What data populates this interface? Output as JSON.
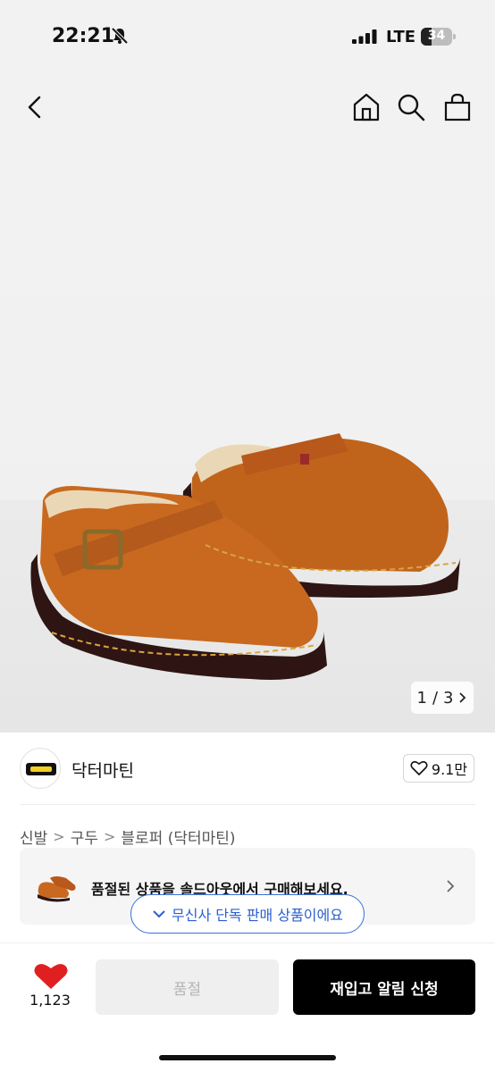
{
  "status_bar": {
    "time": "22:21",
    "network": "LTE",
    "battery": "34",
    "battery_level_percent": 34
  },
  "nav": {
    "icons": [
      "back-icon",
      "home-icon",
      "search-icon",
      "bag-icon"
    ]
  },
  "gallery": {
    "current": "1",
    "separator": "/",
    "total": "3"
  },
  "brand": {
    "name": "닥터마틴",
    "likes": "9.1만"
  },
  "breadcrumb": {
    "items": [
      "신발",
      "구두",
      "블로퍼 (닥터마틴)"
    ]
  },
  "soldout_banner": {
    "text": "품절된 상품을 솔드아웃에서 구매해보세요."
  },
  "exclusive_badge": {
    "text": "무신사 단독 판매 상품이에요"
  },
  "bottom_bar": {
    "like_count": "1,123",
    "soldout_label": "품절",
    "restock_label": "재입고 알림 신청"
  },
  "colors": {
    "accent_blue": "#2b5fcf",
    "heart_red": "#e02020",
    "primary_black": "#000000"
  }
}
